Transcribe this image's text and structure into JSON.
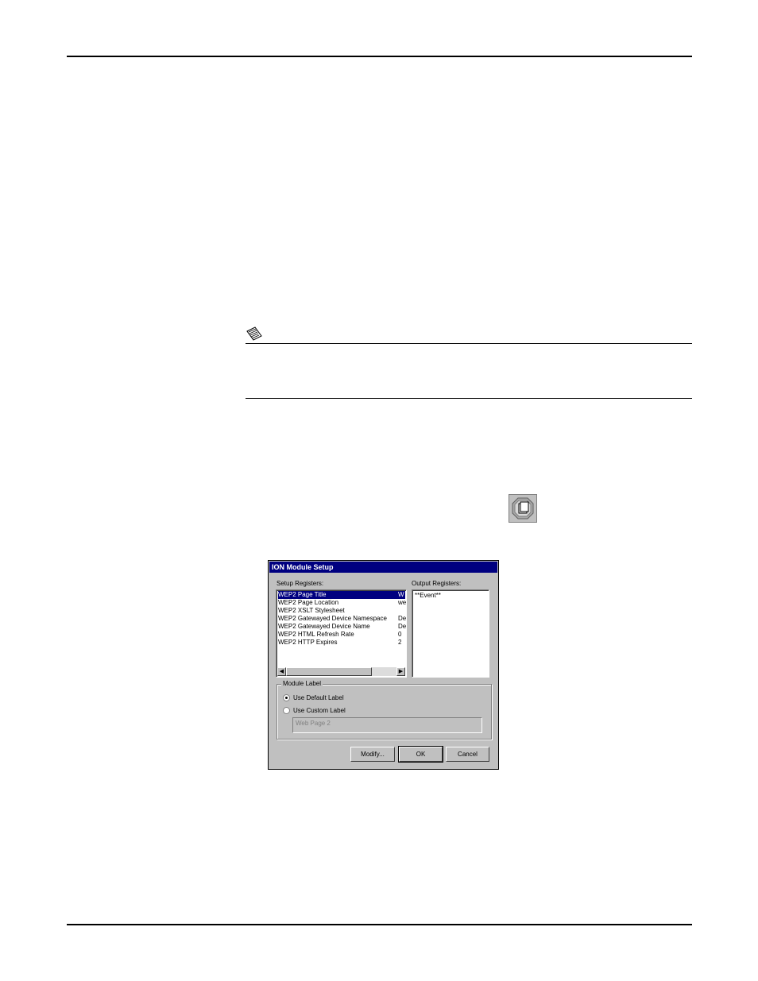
{
  "dialog": {
    "title": "ION Module Setup",
    "setup_registers_label": "Setup Registers:",
    "output_registers_label": "Output Registers:",
    "setup_registers": [
      {
        "name": "WEP2 Page Title",
        "value": "W",
        "selected": true
      },
      {
        "name": "WEP2 Page Location",
        "value": "we"
      },
      {
        "name": "WEP2 XSLT Stylesheet",
        "value": ""
      },
      {
        "name": "WEP2 Gatewayed Device Namespace",
        "value": "De"
      },
      {
        "name": "WEP2 Gatewayed Device Name",
        "value": "De"
      },
      {
        "name": "WEP2 HTML Refresh Rate",
        "value": "0"
      },
      {
        "name": "WEP2 HTTP Expires",
        "value": "2"
      }
    ],
    "output_registers": [
      "**Event**"
    ],
    "module_label": {
      "group_title": "Module Label",
      "use_default_label": "Use Default Label",
      "use_custom_label": "Use Custom Label",
      "selected_option": "default",
      "custom_label_value": "Web Page 2"
    },
    "buttons": {
      "modify": "Modify...",
      "ok": "OK",
      "cancel": "Cancel"
    },
    "colors": {
      "titlebar": "#000080",
      "face": "#c0c0c0"
    }
  },
  "icons": {
    "note": "note-pad-icon",
    "module": "web-page-module-icon"
  }
}
